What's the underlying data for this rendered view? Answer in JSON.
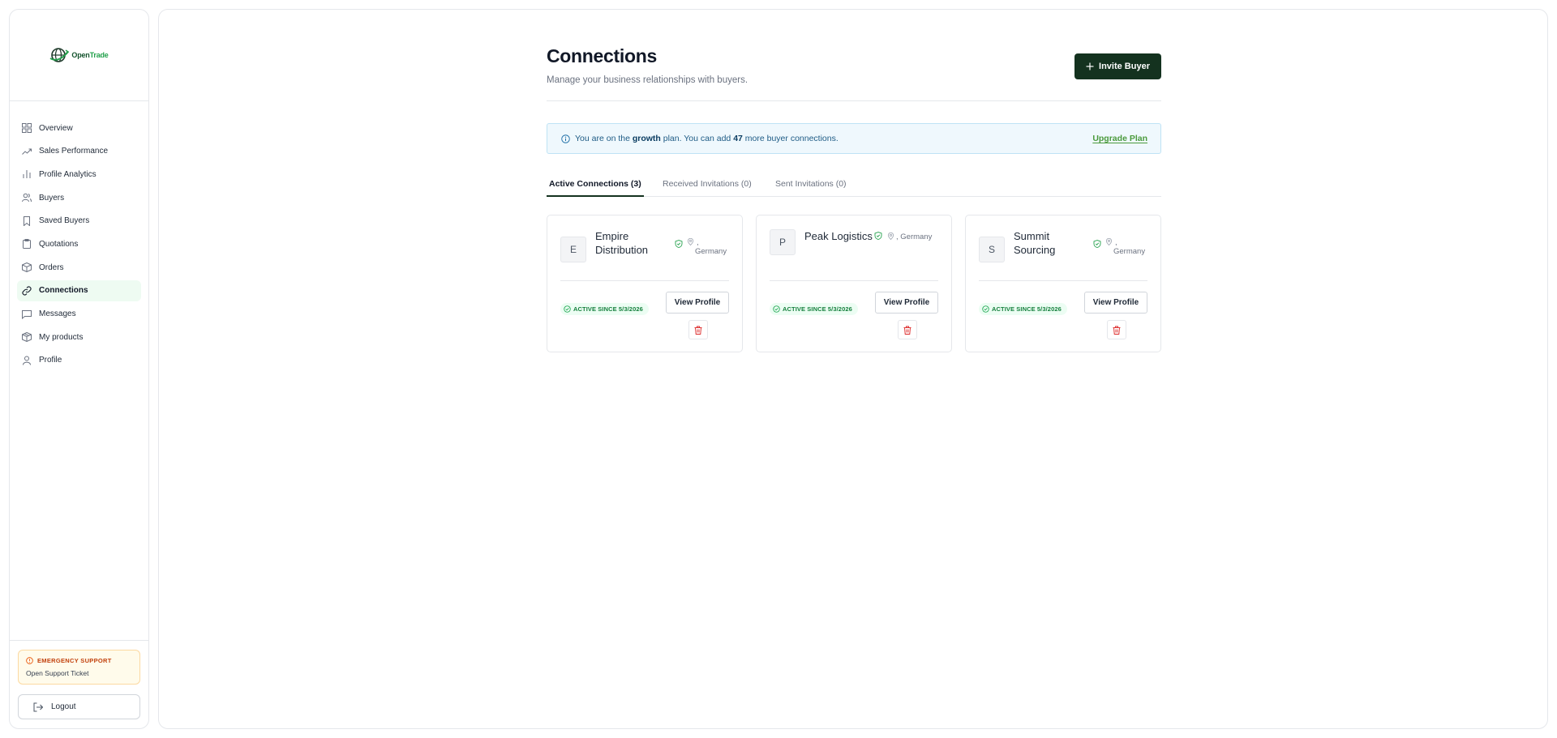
{
  "app": {
    "logo_primary": "Open",
    "logo_secondary": "Trade"
  },
  "sidebar": {
    "items": [
      {
        "label": "Overview",
        "icon": "grid-icon"
      },
      {
        "label": "Sales Performance",
        "icon": "trending-up-icon"
      },
      {
        "label": "Profile Analytics",
        "icon": "bar-chart-icon"
      },
      {
        "label": "Buyers",
        "icon": "users-icon"
      },
      {
        "label": "Saved Buyers",
        "icon": "bookmark-icon"
      },
      {
        "label": "Quotations",
        "icon": "clipboard-icon"
      },
      {
        "label": "Orders",
        "icon": "package-icon"
      },
      {
        "label": "Connections",
        "icon": "link-icon",
        "active": true
      },
      {
        "label": "Messages",
        "icon": "message-icon"
      },
      {
        "label": "My products",
        "icon": "box-icon"
      },
      {
        "label": "Profile",
        "icon": "user-icon"
      }
    ],
    "emergency_title": "EMERGENCY SUPPORT",
    "emergency_link": "Open Support Ticket",
    "logout_label": "Logout"
  },
  "header": {
    "title": "Connections",
    "subtitle": "Manage your business relationships with buyers.",
    "invite_label": "Invite Buyer"
  },
  "banner": {
    "prefix": "You are on the ",
    "plan": "growth",
    "middle": " plan. You can add ",
    "count": "47",
    "suffix": " more buyer connections.",
    "upgrade_label": "Upgrade Plan"
  },
  "tabs": [
    {
      "label": "Active Connections (3)",
      "active": true
    },
    {
      "label": "Received Invitations (0)",
      "active": false
    },
    {
      "label": "Sent Invitations (0)",
      "active": false
    }
  ],
  "connections": [
    {
      "initial": "E",
      "name_line1": "Empire",
      "name_line2": "Distribution",
      "loc_line1": ",",
      "loc_line2": "Germany",
      "badge": "ACTIVE SINCE 5/3/2026",
      "view_label": "View Profile"
    },
    {
      "initial": "P",
      "name_line1": "Peak Logistics",
      "name_line2": "",
      "loc_line1": ", Germany",
      "loc_line2": "",
      "badge": "ACTIVE SINCE 5/3/2026",
      "view_label": "View Profile"
    },
    {
      "initial": "S",
      "name_line1": "Summit",
      "name_line2": "Sourcing",
      "loc_line1": ",",
      "loc_line2": "Germany",
      "badge": "ACTIVE SINCE 5/3/2026",
      "view_label": "View Profile"
    }
  ],
  "colors": {
    "brand_dark": "#14321f",
    "brand_green": "#22a04b",
    "active_nav_bg": "#eefbf2",
    "danger": "#dc2626",
    "info_bg": "#eff8fd"
  }
}
